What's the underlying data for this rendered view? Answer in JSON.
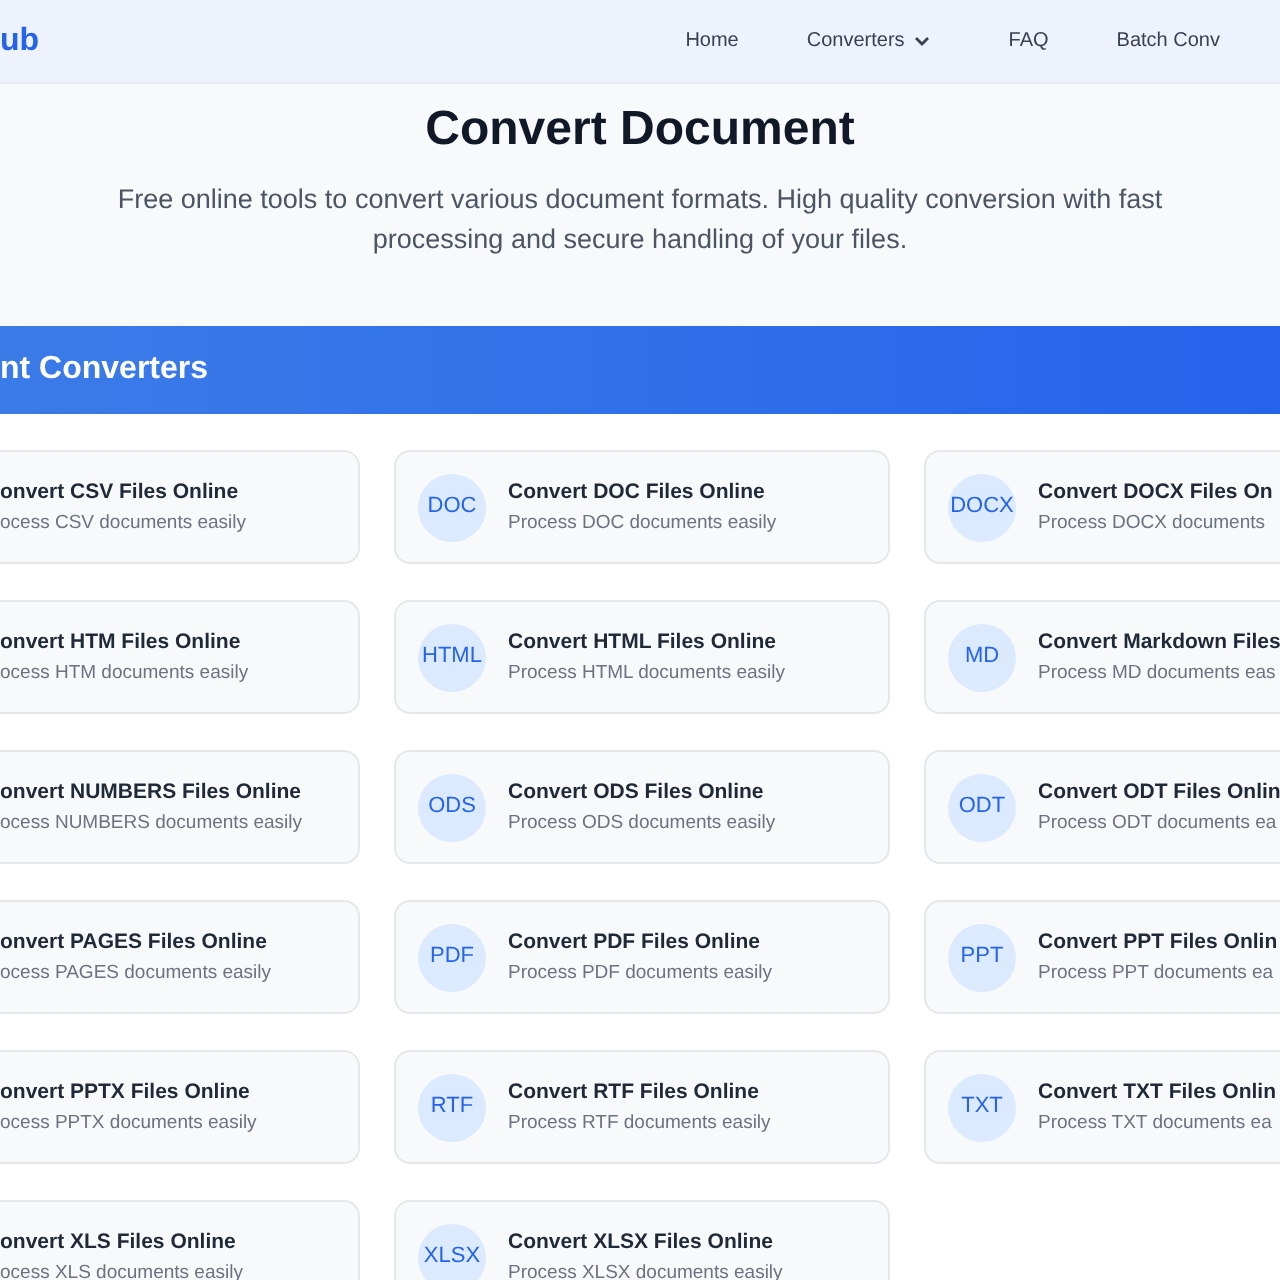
{
  "header": {
    "logo": "ub",
    "nav": [
      {
        "label": "Home",
        "kind": "link"
      },
      {
        "label": "Converters",
        "kind": "dropdown"
      },
      {
        "label": "FAQ",
        "kind": "link"
      },
      {
        "label": "Batch Conv",
        "kind": "link"
      }
    ]
  },
  "hero": {
    "title": "Convert Document",
    "subtitle": "Free online tools to convert various document formats. High quality conversion with fast processing and secure handling of your files."
  },
  "section": {
    "title": "nt Converters",
    "cards": [
      {
        "title": "onvert CSV Files Online",
        "description": "ocess CSV documents easily"
      },
      {
        "badge": "DOC",
        "title": "Convert DOC Files Online",
        "description": "Process DOC documents easily"
      },
      {
        "badge": "DOCX",
        "title": "Convert DOCX Files On",
        "description": "Process DOCX documents"
      },
      {
        "title": "onvert HTM Files Online",
        "description": "ocess HTM documents easily"
      },
      {
        "badge": "HTML",
        "title": "Convert HTML Files Online",
        "description": "Process HTML documents easily"
      },
      {
        "badge": "MD",
        "title": "Convert Markdown Files",
        "description": "Process MD documents eas"
      },
      {
        "title": "onvert NUMBERS Files Online",
        "description": "ocess NUMBERS documents easily"
      },
      {
        "badge": "ODS",
        "title": "Convert ODS Files Online",
        "description": "Process ODS documents easily"
      },
      {
        "badge": "ODT",
        "title": "Convert ODT Files Onlin",
        "description": "Process ODT documents ea"
      },
      {
        "title": "onvert PAGES Files Online",
        "description": "ocess PAGES documents easily"
      },
      {
        "badge": "PDF",
        "title": "Convert PDF Files Online",
        "description": "Process PDF documents easily"
      },
      {
        "badge": "PPT",
        "title": "Convert PPT Files Onlin",
        "description": "Process PPT documents ea"
      },
      {
        "title": "onvert PPTX Files Online",
        "description": "ocess PPTX documents easily"
      },
      {
        "badge": "RTF",
        "title": "Convert RTF Files Online",
        "description": "Process RTF documents easily"
      },
      {
        "badge": "TXT",
        "title": "Convert TXT Files Onlin",
        "description": "Process TXT documents ea"
      },
      {
        "title": "onvert XLS Files Online",
        "description": "ocess XLS documents easily"
      },
      {
        "badge": "XLSX",
        "title": "Convert XLSX Files Online",
        "description": "Process XLSX documents easily"
      }
    ]
  }
}
